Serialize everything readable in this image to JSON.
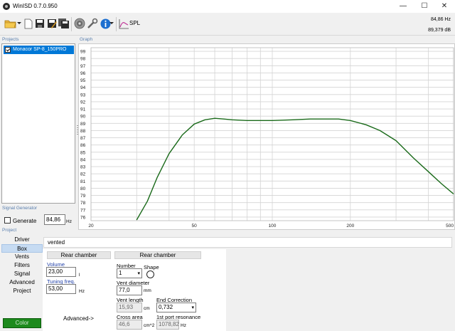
{
  "window": {
    "title": "WinISD 0.7.0.950",
    "minimize": "—",
    "maximize": "☐",
    "close": "✕"
  },
  "toolbar": {
    "spl_label": "SPL",
    "freq_readout": "84,86 Hz",
    "spl_readout": "89,379 dB",
    "icons": [
      "open-folder-icon",
      "new-document-icon",
      "save-icon",
      "save-as-icon",
      "save-all-icon",
      "driver-icon",
      "tools-icon",
      "info-icon",
      "spl-graph-icon"
    ]
  },
  "sections": {
    "projects": "Projects",
    "graph": "Graph",
    "signal_generator": "Signal Generator",
    "project": "Project"
  },
  "projects": [
    {
      "name": "Monacor SP-8_150PRO",
      "checked": true
    }
  ],
  "chart_data": {
    "type": "line",
    "x_scale": "log",
    "xlim": [
      20,
      500
    ],
    "ylim": [
      75.5,
      99.5
    ],
    "x_ticks": [
      20,
      50,
      100,
      200,
      500
    ],
    "y_ticks": [
      76,
      77,
      78,
      79,
      80,
      81,
      82,
      83,
      84,
      85,
      86,
      87,
      88,
      89,
      90,
      91,
      92,
      93,
      94,
      95,
      96,
      97,
      98,
      99
    ],
    "grid": true,
    "series": [
      {
        "color": "#1a6a1a",
        "x": [
          30,
          33,
          36,
          40,
          45,
          50,
          55,
          60,
          65,
          70,
          80,
          90,
          100,
          120,
          140,
          160,
          180,
          200,
          230,
          260,
          300,
          350,
          400,
          450,
          500
        ],
        "y": [
          75.6,
          78.2,
          81.5,
          84.8,
          87.4,
          88.9,
          89.5,
          89.7,
          89.6,
          89.5,
          89.4,
          89.4,
          89.4,
          89.5,
          89.6,
          89.6,
          89.6,
          89.4,
          88.8,
          88.0,
          86.6,
          84.2,
          82.3,
          80.6,
          79.2
        ]
      }
    ]
  },
  "signal_generator": {
    "label": "Generate",
    "checked": false,
    "value": "84,86",
    "unit": "Hz"
  },
  "nav": {
    "items": [
      {
        "label": "Driver",
        "active": false
      },
      {
        "label": "Box",
        "active": true
      },
      {
        "label": "Vents",
        "active": false
      },
      {
        "label": "Filters",
        "active": false
      },
      {
        "label": "Signal",
        "active": false
      },
      {
        "label": "Advanced",
        "active": false
      },
      {
        "label": "Project",
        "active": false
      }
    ],
    "color_button": "Color",
    "color": "#1d8a1d"
  },
  "box": {
    "type": "vented",
    "left_group": "Rear chamber",
    "right_group": "Rear chamber",
    "volume_label": "Volume",
    "volume_value": "23,00",
    "volume_unit": "l",
    "tuning_label": "Tuning freq.",
    "tuning_value": "53,00",
    "tuning_unit": "Hz",
    "advanced_label": "Advanced->",
    "number_label": "Number",
    "number_value": "1",
    "shape_label": "Shape",
    "vent_diameter_label": "Vent diameter",
    "vent_diameter_value": "77,0",
    "vent_diameter_unit": "mm",
    "vent_length_label": "Vent length",
    "vent_length_value": "15,93",
    "vent_length_unit": "cm",
    "end_correction_label": "End Correction",
    "end_correction_value": "0,732",
    "cross_area_label": "Cross area",
    "cross_area_value": "46,6",
    "cross_area_unit": "cm^2",
    "port_resonance_label": "1st port resonance",
    "port_resonance_value": "1078,82",
    "port_resonance_unit": "Hz"
  }
}
